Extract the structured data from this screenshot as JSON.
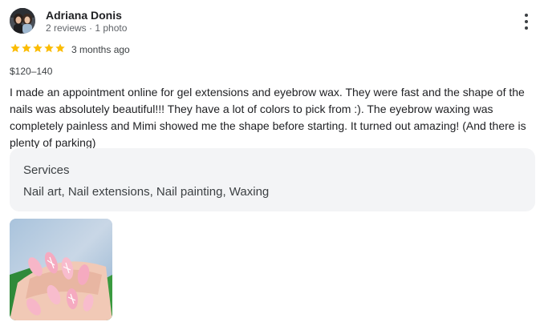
{
  "reviewer": {
    "name": "Adriana Donis",
    "meta": "2 reviews · 1 photo",
    "avatar_icon": "profile-photo"
  },
  "menu": {
    "icon": "more-vertical-icon"
  },
  "rating": {
    "stars": 5,
    "max_stars": 5,
    "star_color": "#fbbc04",
    "date": "3 months ago"
  },
  "price": "$120–140",
  "review_text": "I made an appointment online for gel extensions and eyebrow wax. They were fast and the shape of the nails was absolutely beautiful!!! They have a lot of colors to pick from :). The eyebrow waxing was completely painless and Mimi showed me the shape before starting. It turned out amazing! (And there is plenty of parking)",
  "services": {
    "heading": "Services",
    "list": "Nail art, Nail extensions, Nail painting, Waxing"
  },
  "photos": {
    "count": 1,
    "icon": "nail-photo"
  }
}
